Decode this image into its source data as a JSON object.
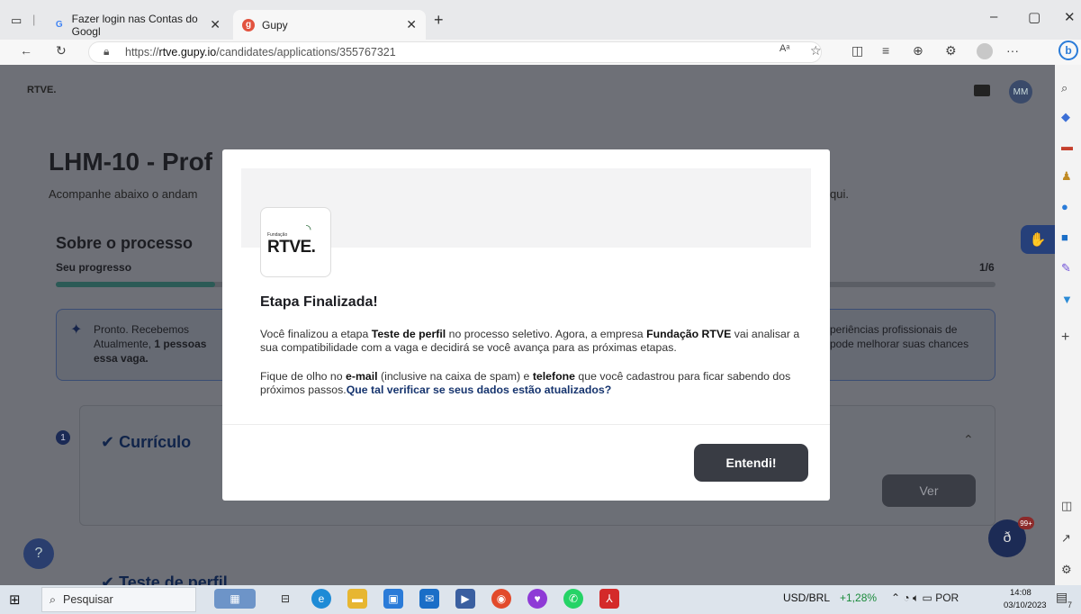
{
  "browser": {
    "tabs": [
      {
        "label": "Fazer login nas Contas do Googl",
        "icon": "google-icon"
      },
      {
        "label": "Gupy",
        "icon": "gupy-icon"
      }
    ],
    "url_prefix": "https://",
    "url_domain": "rtve.gupy.io",
    "url_path": "/candidates/applications/355767321"
  },
  "page": {
    "logo": "RTVE.",
    "avatar_initials": "MM",
    "title": "LHM-10 - Prof",
    "subtitle": "Acompanhe abaixo o andam",
    "subtitle_tail": "qui.",
    "section_title": "Sobre o processo",
    "progress_label": "Seu progresso",
    "progress_count": "1/6",
    "progress_fraction": 0.17,
    "info_left_1": "Pronto. Recebemos",
    "info_left_2_pre": "Atualmente, ",
    "info_left_2_bold": "1 pessoas",
    "info_left_3": "essa vaga.",
    "info_right_1": "periências profissionais de",
    "info_right_2": "pode melhorar suas chances",
    "step_number": "1",
    "step_title": "Currículo",
    "ver_button": "Ver",
    "next_step_peek": "Teste de perfil",
    "help_label": "?",
    "notif_badge": "99+"
  },
  "modal": {
    "logo_small": "Fundação",
    "logo_text": "RTVE.",
    "title": "Etapa Finalizada!",
    "p1_a": "Você finalizou a etapa ",
    "p1_b": "Teste de perfil",
    "p1_c": " no processo seletivo. Agora, a empresa ",
    "p1_d": "Fundação RTVE",
    "p1_e": " vai analisar a sua compatibilidade com a vaga e decidirá se você avança para as próximas etapas.",
    "p2_a": "Fique de olho no ",
    "p2_b": "e-mail",
    "p2_c": " (inclusive na caixa de spam) e ",
    "p2_d": "telefone",
    "p2_e": " que você cadastrou para ficar sabendo dos próximos passos.",
    "p2_link": "Que tal verificar se seus dados estão atualizados?",
    "button": "Entendi!"
  },
  "taskbar": {
    "search": "Pesquisar",
    "ticker": "USD/BRL",
    "ticker_change": "+1,28%",
    "lang": "POR",
    "time": "14:08",
    "date": "03/10/2023",
    "notif_count": "7"
  },
  "colors": {
    "accent": "#393c44",
    "link": "#16346e",
    "overlay": "#6e7077"
  }
}
